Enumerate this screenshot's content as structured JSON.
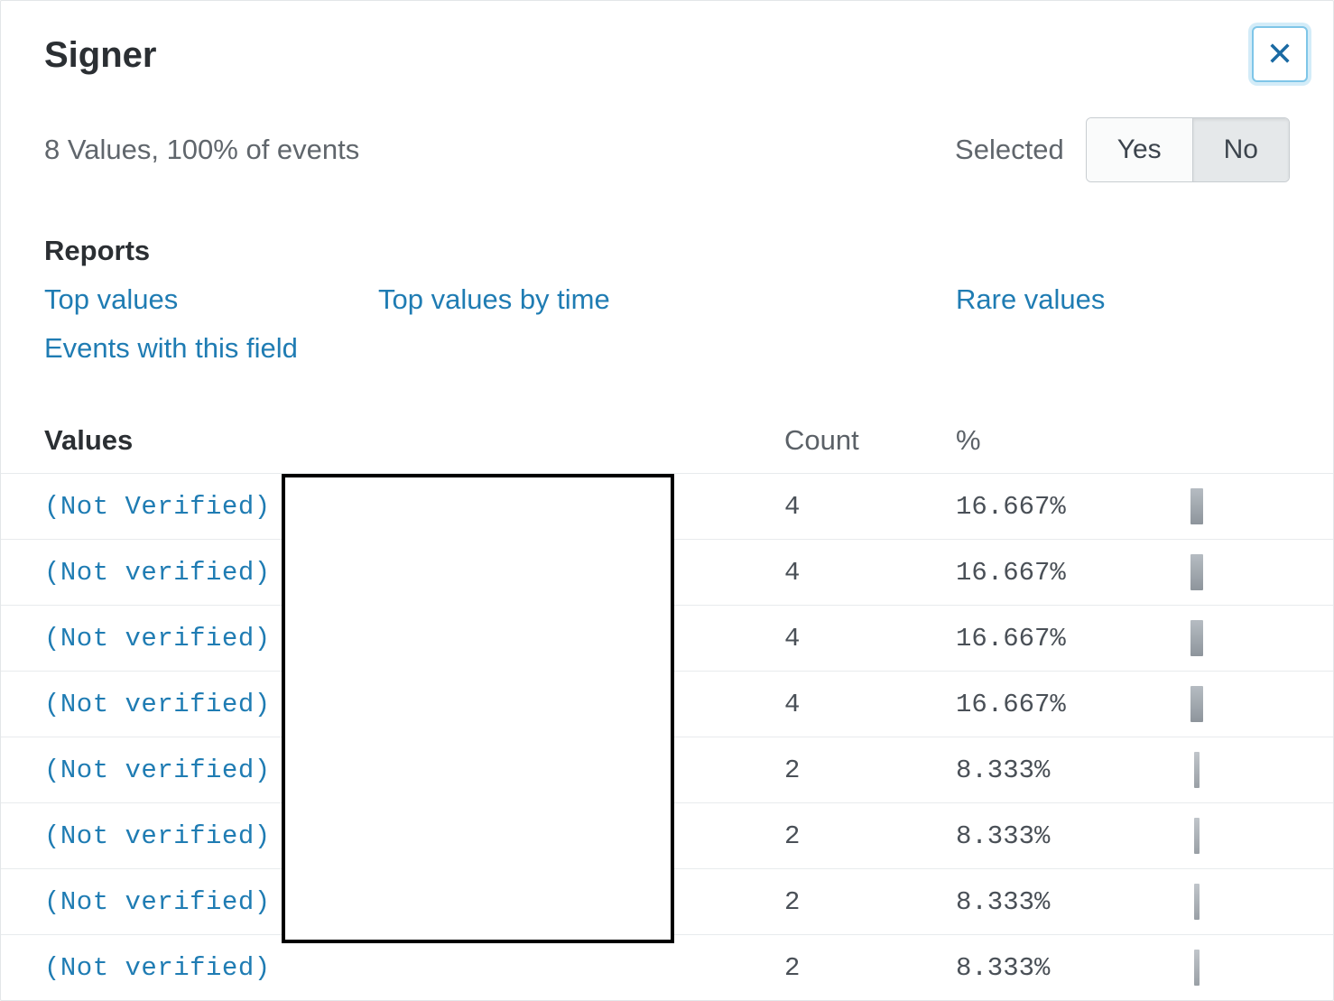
{
  "header": {
    "title": "Signer"
  },
  "summary": "8 Values, 100% of events",
  "selected": {
    "label": "Selected",
    "yes": "Yes",
    "no": "No",
    "active": "No"
  },
  "reports": {
    "title": "Reports",
    "links": {
      "top_values": "Top values",
      "top_values_by_time": "Top values by time",
      "rare_values": "Rare values",
      "events_with_field": "Events with this field"
    }
  },
  "table": {
    "headers": {
      "values": "Values",
      "count": "Count",
      "percent": "%"
    },
    "rows": [
      {
        "value": "(Not Verified)",
        "count": "4",
        "percent": "16.667%",
        "bar": "wide"
      },
      {
        "value": "(Not verified)",
        "count": "4",
        "percent": "16.667%",
        "bar": "wide"
      },
      {
        "value": "(Not verified)",
        "count": "4",
        "percent": "16.667%",
        "bar": "wide"
      },
      {
        "value": "(Not verified)",
        "count": "4",
        "percent": "16.667%",
        "bar": "wide"
      },
      {
        "value": "(Not verified)",
        "count": "2",
        "percent": "8.333%",
        "bar": "thin"
      },
      {
        "value": "(Not verified)",
        "count": "2",
        "percent": "8.333%",
        "bar": "thin"
      },
      {
        "value": "(Not verified)",
        "count": "2",
        "percent": "8.333%",
        "bar": "thin"
      },
      {
        "value": "(Not verified)",
        "count": "2",
        "percent": "8.333%",
        "bar": "thin"
      }
    ]
  }
}
